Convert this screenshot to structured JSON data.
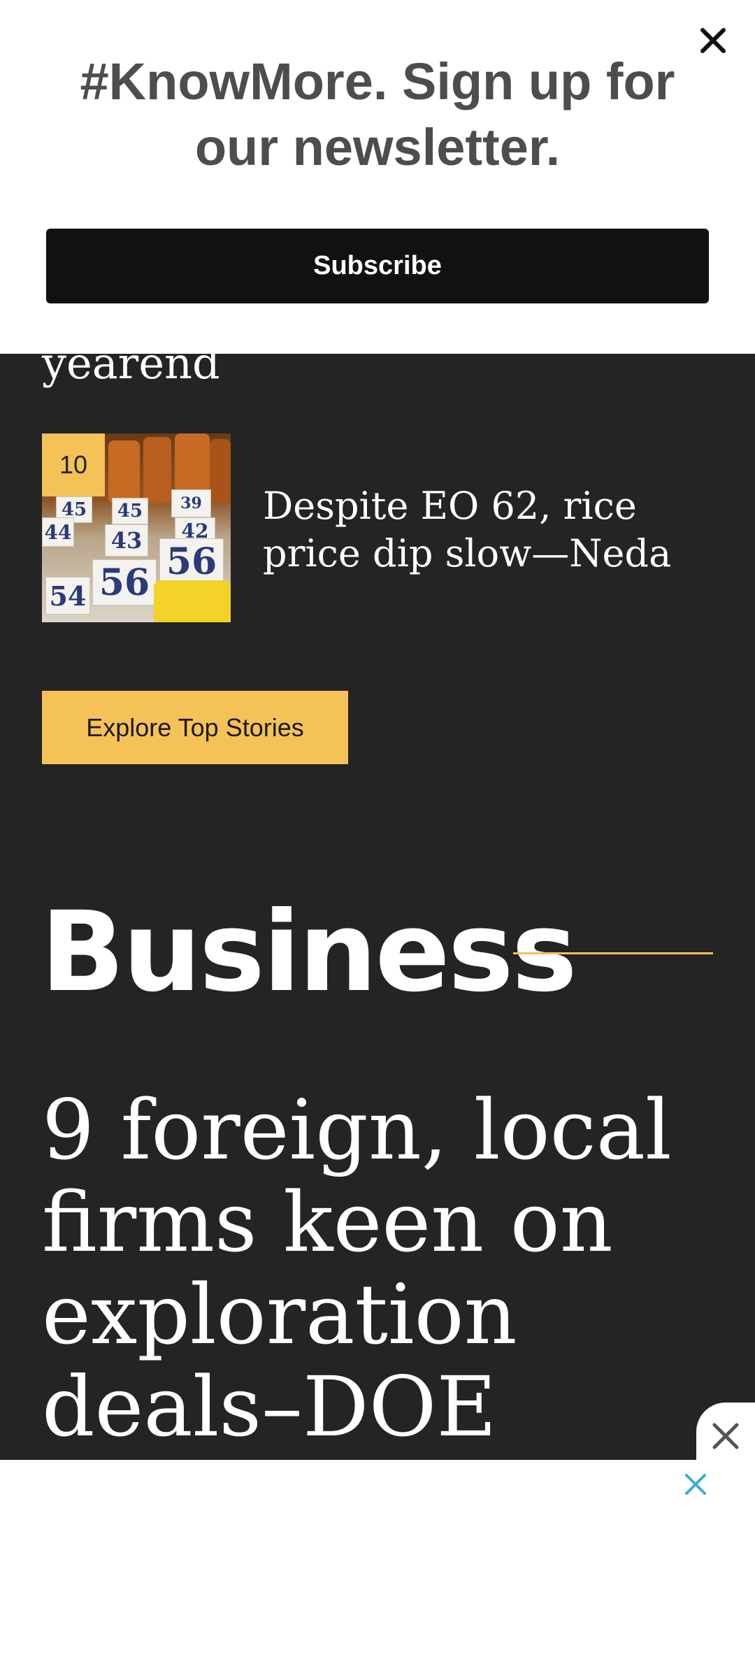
{
  "newsletter": {
    "title": "#KnowMore. Sign up for our newsletter.",
    "subscribe_label": "Subscribe",
    "close_icon": "close-icon"
  },
  "top_stories": {
    "previous_headline_fragment": "yearend",
    "items": [
      {
        "rank": "10",
        "title": "Despite EO 62, rice price dip slow—Neda",
        "thumbnail_icon": "rice-market-thumbnail"
      }
    ],
    "explore_label": "Explore Top Stories"
  },
  "business": {
    "heading": "Business",
    "lead_headline": "9 foreign, local firms keen on exploration deals–DOE"
  },
  "ad": {
    "close_icon": "close-icon",
    "adchoices_close_icon": "close-icon"
  },
  "colors": {
    "page_background": "#242424",
    "accent": "#f5c257",
    "subscribe_button": "#111111",
    "newsletter_title": "#4d4d4d",
    "adchoices_blue": "#3fa9d9"
  }
}
